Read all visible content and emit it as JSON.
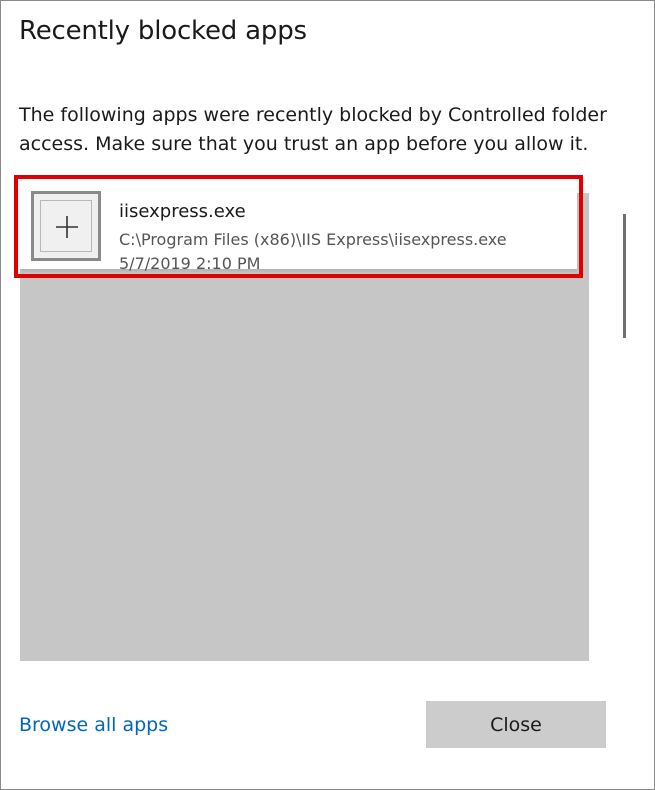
{
  "dialog": {
    "title": "Recently blocked apps",
    "description": "The following apps were recently blocked by Controlled folder access. Make sure that you trust an app before you allow it."
  },
  "blocked_apps": [
    {
      "name": "iisexpress.exe",
      "path": "C:\\Program Files (x86)\\IIS Express\\iisexpress.exe",
      "time": "5/7/2019 2:10 PM",
      "icon": "plus-icon"
    }
  ],
  "footer": {
    "browse_label": "Browse all apps",
    "close_label": "Close"
  },
  "colors": {
    "highlight": "#e00000",
    "link": "#0067b8",
    "list_background": "#c6c6c6",
    "button_background": "#cccccc"
  }
}
